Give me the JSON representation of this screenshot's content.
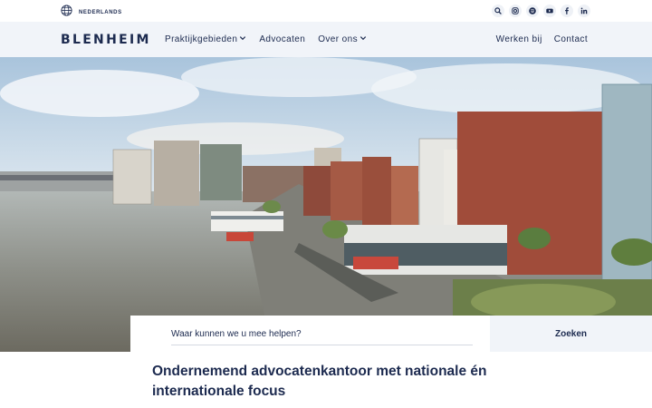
{
  "topbar": {
    "language_label": "NEDERLANDS",
    "language_icon": "globe-icon",
    "social_icons": [
      "search-icon",
      "instagram-icon",
      "spotify-icon",
      "youtube-icon",
      "facebook-icon",
      "linkedin-icon"
    ]
  },
  "nav": {
    "logo": "BLENHEIM",
    "items": [
      {
        "label": "Praktijkgebieden",
        "has_dropdown": true
      },
      {
        "label": "Advocaten",
        "has_dropdown": false
      },
      {
        "label": "Over ons",
        "has_dropdown": true
      }
    ],
    "right_items": [
      {
        "label": "Werken bij"
      },
      {
        "label": "Contact"
      }
    ]
  },
  "search": {
    "placeholder": "Waar kunnen we u mee helpen?",
    "value": "",
    "button_label": "Zoeken"
  },
  "headline": "Ondernemend advocatenkantoor met nationale én internationale focus",
  "colors": {
    "brand_navy": "#1c2a4f",
    "nav_background": "#f1f4f9"
  }
}
